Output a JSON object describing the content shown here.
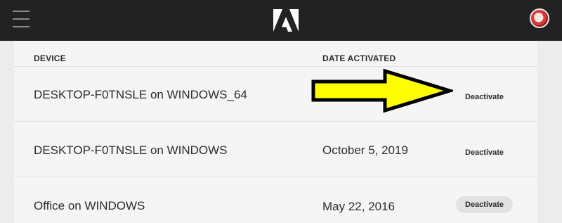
{
  "header": {
    "menu_icon": "hamburger-menu-icon",
    "logo_icon": "adobe-logo-icon",
    "avatar_icon": "user-avatar"
  },
  "table": {
    "columns": [
      "DEVICE",
      "DATE ACTIVATED"
    ],
    "rows": [
      {
        "device": "DESKTOP-F0TNSLE on WINDOWS_64",
        "date": "",
        "action": "Deactivate"
      },
      {
        "device": "DESKTOP-F0TNSLE on WINDOWS",
        "date": "October 5, 2019",
        "action": "Deactivate"
      },
      {
        "device": "Office on WINDOWS",
        "date": "May 22, 2016",
        "action": "Deactivate"
      }
    ]
  },
  "annotation": {
    "arrow_color": "#ffff00",
    "arrow_outline": "#000000"
  },
  "colors": {
    "topbar": "#222222",
    "background": "#ececec",
    "panel": "#f5f5f5"
  }
}
